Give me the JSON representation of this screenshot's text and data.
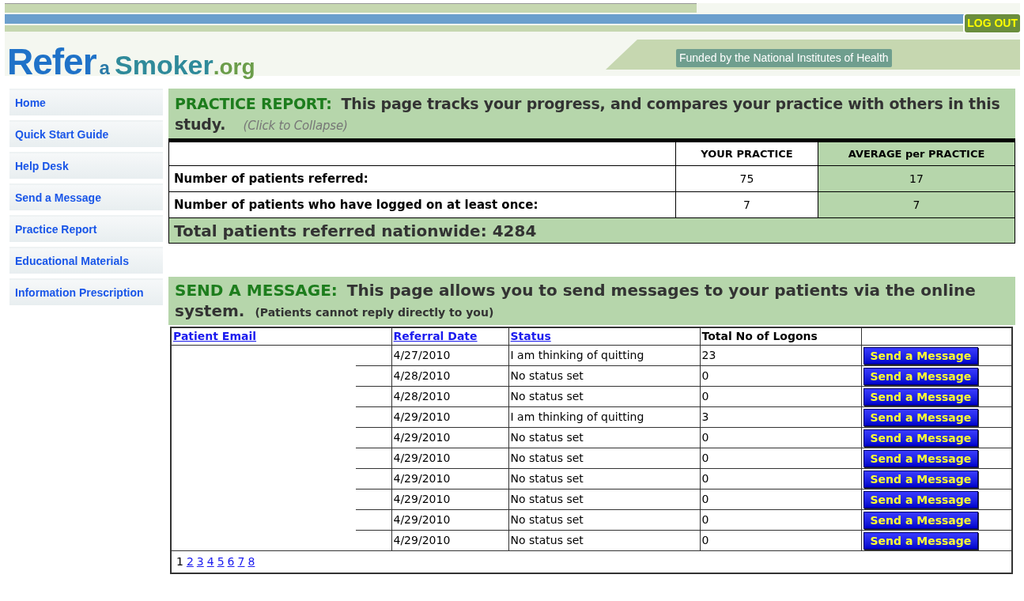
{
  "header": {
    "logo": [
      {
        "text": "Refer",
        "kind": "big"
      },
      {
        "text": "a",
        "kind": "small"
      },
      {
        "text": "Smoker",
        "kind": "mid"
      },
      {
        "text": ".org",
        "kind": "org"
      }
    ],
    "funding": "Funded by the National Institutes of Health",
    "logout": "LOG OUT"
  },
  "sidebar": {
    "items": [
      {
        "label": "Home"
      },
      {
        "label": "Quick Start Guide"
      },
      {
        "label": "Help Desk"
      },
      {
        "label": "Send a Message"
      },
      {
        "label": "Practice Report"
      },
      {
        "label": "Educational Materials"
      },
      {
        "label": "Information Prescription"
      }
    ]
  },
  "practice_report": {
    "heading": "PRACTICE REPORT:",
    "description": "This page tracks your progress, and compares your practice with others in this study.",
    "collapse": "(Click to Collapse)",
    "columns": [
      "YOUR PRACTICE",
      "AVERAGE per PRACTICE"
    ],
    "rows": [
      {
        "label": "Number of patients referred:",
        "yours": "75",
        "average": "17"
      },
      {
        "label": "Number of patients who have logged on at least once:",
        "yours": "7",
        "average": "7"
      }
    ],
    "total": "Total patients referred nationwide: 4284"
  },
  "send_message": {
    "heading": "SEND A MESSAGE:",
    "description": "This page allows you to send messages to your patients via the online system.",
    "note": "(Patients cannot reply directly to you)",
    "columns": [
      {
        "label": "Patient Email",
        "link": true
      },
      {
        "label": "Referral Date",
        "link": true
      },
      {
        "label": "Status",
        "link": true
      },
      {
        "label": "Total No of Logons",
        "link": false
      }
    ],
    "rows": [
      {
        "date": "4/27/2010",
        "status": "I am thinking of quitting",
        "logons": "23",
        "button": "Send a Message"
      },
      {
        "date": "4/28/2010",
        "status": "No status set",
        "logons": "0",
        "button": "Send a Message"
      },
      {
        "date": "4/28/2010",
        "status": "No status set",
        "logons": "0",
        "button": "Send a Message"
      },
      {
        "date": "4/29/2010",
        "status": "I am thinking of quitting",
        "logons": "3",
        "button": "Send a Message"
      },
      {
        "date": "4/29/2010",
        "status": "No status set",
        "logons": "0",
        "button": "Send a Message"
      },
      {
        "date": "4/29/2010",
        "status": "No status set",
        "logons": "0",
        "button": "Send a Message"
      },
      {
        "date": "4/29/2010",
        "status": "No status set",
        "logons": "0",
        "button": "Send a Message"
      },
      {
        "date": "4/29/2010",
        "status": "No status set",
        "logons": "0",
        "button": "Send a Message"
      },
      {
        "date": "4/29/2010",
        "status": "No status set",
        "logons": "0",
        "button": "Send a Message"
      },
      {
        "date": "4/29/2010",
        "status": "No status set",
        "logons": "0",
        "button": "Send a Message"
      }
    ],
    "pages": [
      {
        "label": "1",
        "selected": true
      },
      {
        "label": "2",
        "selected": false
      },
      {
        "label": "3",
        "selected": false
      },
      {
        "label": "4",
        "selected": false
      },
      {
        "label": "5",
        "selected": false
      },
      {
        "label": "6",
        "selected": false
      },
      {
        "label": "7",
        "selected": false
      },
      {
        "label": "8",
        "selected": false
      }
    ]
  }
}
